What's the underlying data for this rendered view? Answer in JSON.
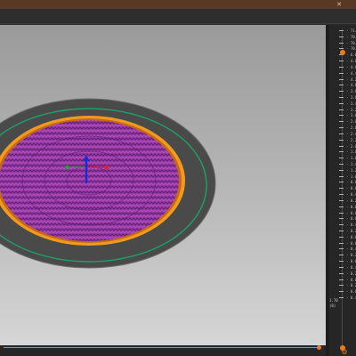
{
  "window": {
    "close_glyph": "✕"
  },
  "viewport": {
    "colors": {
      "bed": "#4a4a4a",
      "bed_edge": "#6a6a6a",
      "green_ring": "#1fa06a",
      "orange_ring": "#f29a1f",
      "infill": "#9b3aa6",
      "infill_dark": "#5d1f75",
      "axis_x": "#d9202a",
      "axis_y": "#22a33a",
      "axis_z": "#1a2bd6"
    }
  },
  "layer_slider": {
    "ticks": [
      "- 71.0",
      "- 70.4",
      "- 70.2",
      "- 70.0",
      "- 6.0",
      "- 4.8",
      "- 4.6",
      "- 4.4",
      "- 4.2",
      "- 4.0",
      "- 3.8",
      "- 3.6",
      "- 3.4",
      "- 3.2",
      "- 3.0",
      "- 2.8",
      "- 2.6",
      "- 2.4",
      "- 2.2",
      "- 2.0",
      "- 1.8",
      "- 1.6",
      "- 1.4",
      "- 1.2",
      "- 1.0",
      "- 0.8",
      "- 0.6",
      "- 0.4",
      "- 0.2",
      "- 0.0",
      "- 0.8",
      "- 0.6",
      "- 0.4",
      "- 0.2",
      "- 0.0",
      "- 0.6",
      "- 0.4",
      "- 0.2",
      "- 0.0",
      "- 0.4",
      "- 0.2",
      "- 0.0",
      "- 0.2",
      "- 0.0",
      "- 0.4"
    ],
    "readout_line1": "1.70",
    "readout_line2": "(8)",
    "bottom_icon": "⚙"
  },
  "move_slider": {
    "value": "4097"
  }
}
